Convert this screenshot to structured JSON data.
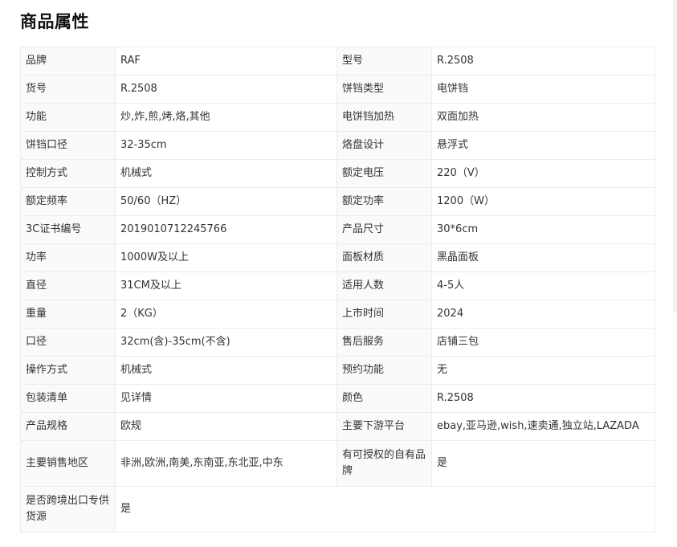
{
  "title": "商品属性",
  "rows": [
    {
      "k1": "品牌",
      "v1": "RAF",
      "k2": "型号",
      "v2": "R.2508"
    },
    {
      "k1": "货号",
      "v1": "R.2508",
      "k2": "饼铛类型",
      "v2": "电饼铛"
    },
    {
      "k1": "功能",
      "v1": "炒,炸,煎,烤,烙,其他",
      "k2": "电饼铛加热",
      "v2": "双面加热"
    },
    {
      "k1": "饼铛口径",
      "v1": "32-35cm",
      "k2": "烙盘设计",
      "v2": "悬浮式"
    },
    {
      "k1": "控制方式",
      "v1": "机械式",
      "k2": "额定电压",
      "v2": "220（V）"
    },
    {
      "k1": "额定频率",
      "v1": "50/60（HZ）",
      "k2": "额定功率",
      "v2": "1200（W）"
    },
    {
      "k1": "3C证书编号",
      "v1": "2019010712245766",
      "k2": "产品尺寸",
      "v2": "30*6cm"
    },
    {
      "k1": "功率",
      "v1": "1000W及以上",
      "k2": "面板材质",
      "v2": "黑晶面板"
    },
    {
      "k1": "直径",
      "v1": "31CM及以上",
      "k2": "适用人数",
      "v2": "4-5人"
    },
    {
      "k1": "重量",
      "v1": "2（KG）",
      "k2": "上市时间",
      "v2": "2024"
    },
    {
      "k1": "口径",
      "v1": "32cm(含)-35cm(不含)",
      "k2": "售后服务",
      "v2": "店铺三包"
    },
    {
      "k1": "操作方式",
      "v1": "机械式",
      "k2": "预约功能",
      "v2": "无"
    },
    {
      "k1": "包装清单",
      "v1": "见详情",
      "k2": "颜色",
      "v2": "R.2508"
    },
    {
      "k1": "产品规格",
      "v1": "欧规",
      "k2": "主要下游平台",
      "v2": "ebay,亚马逊,wish,速卖通,独立站,LAZADA"
    },
    {
      "k1": "主要销售地区",
      "v1": "非洲,欧洲,南美,东南亚,东北亚,中东",
      "k2": "有可授权的自有品牌",
      "v2": "是"
    },
    {
      "k1": "是否跨境出口专供货源",
      "v1": "是"
    }
  ]
}
